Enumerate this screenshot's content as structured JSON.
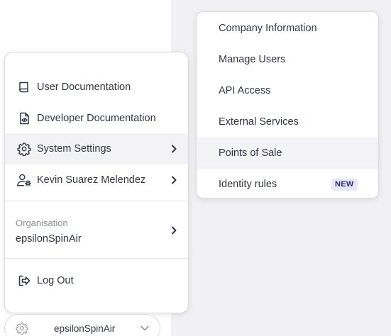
{
  "main_menu": {
    "items": [
      {
        "label": "User Documentation",
        "icon": "book-icon"
      },
      {
        "label": "Developer Documentation",
        "icon": "code-file-icon"
      },
      {
        "label": "System Settings",
        "icon": "gear-icon",
        "active": true
      },
      {
        "label": "Kevin Suarez Melendez",
        "icon": "user-settings-icon"
      }
    ],
    "organisation": {
      "caption": "Organisation",
      "name": "epsilonSpinAir"
    },
    "logout": {
      "label": "Log Out",
      "icon": "logout-icon"
    }
  },
  "sub_menu": {
    "items": [
      {
        "label": "Company Information"
      },
      {
        "label": "Manage Users"
      },
      {
        "label": "API Access"
      },
      {
        "label": "External Services"
      },
      {
        "label": "Points of Sale",
        "active": true
      },
      {
        "label": "Identity rules",
        "badge": "NEW"
      }
    ]
  },
  "switcher": {
    "label": "epsilonSpinAir",
    "icon": "gear-icon"
  },
  "colors": {
    "text": "#2f3545",
    "muted": "#8a8e99",
    "hover_bg": "#f3f3f5",
    "badge_bg": "#e9e6f7",
    "badge_text": "#2e2a72",
    "page_bg_right": "#f1f1f3"
  }
}
